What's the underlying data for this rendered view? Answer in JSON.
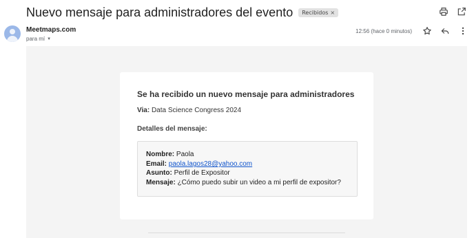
{
  "email": {
    "subject": "Nuevo mensaje para administradores del evento",
    "label_chip": "Recibidos",
    "label_chip_close": "×",
    "sender": "Meetmaps.com",
    "to": "para mí",
    "time": "12:56 (hace 0 minutos)"
  },
  "icons": {
    "print": "print-icon",
    "open_new_window": "open-in-new-icon",
    "star": "star-icon",
    "reply": "reply-icon",
    "more": "more-vert-icon",
    "to_caret": "caret-down-icon"
  },
  "body": {
    "title": "Se ha recibido un nuevo mensaje para administradores",
    "via_label": "Via:",
    "via_value": "Data Science Congress 2024",
    "details_title": "Detalles del mensaje:",
    "fields": {
      "nombre_label": "Nombre:",
      "nombre_value": "Paola",
      "email_label": "Email:",
      "email_value": "paola.lagos28@yahoo.com",
      "asunto_label": "Asunto:",
      "asunto_value": "Perfil de Expositor",
      "mensaje_label": "Mensaje:",
      "mensaje_value": "¿Cómo puedo subir un video a mi perfil de expositor?"
    }
  },
  "colors": {
    "link": "#1155cc",
    "content_background": "#f4f4f4",
    "avatar": "#9bb8e8"
  }
}
